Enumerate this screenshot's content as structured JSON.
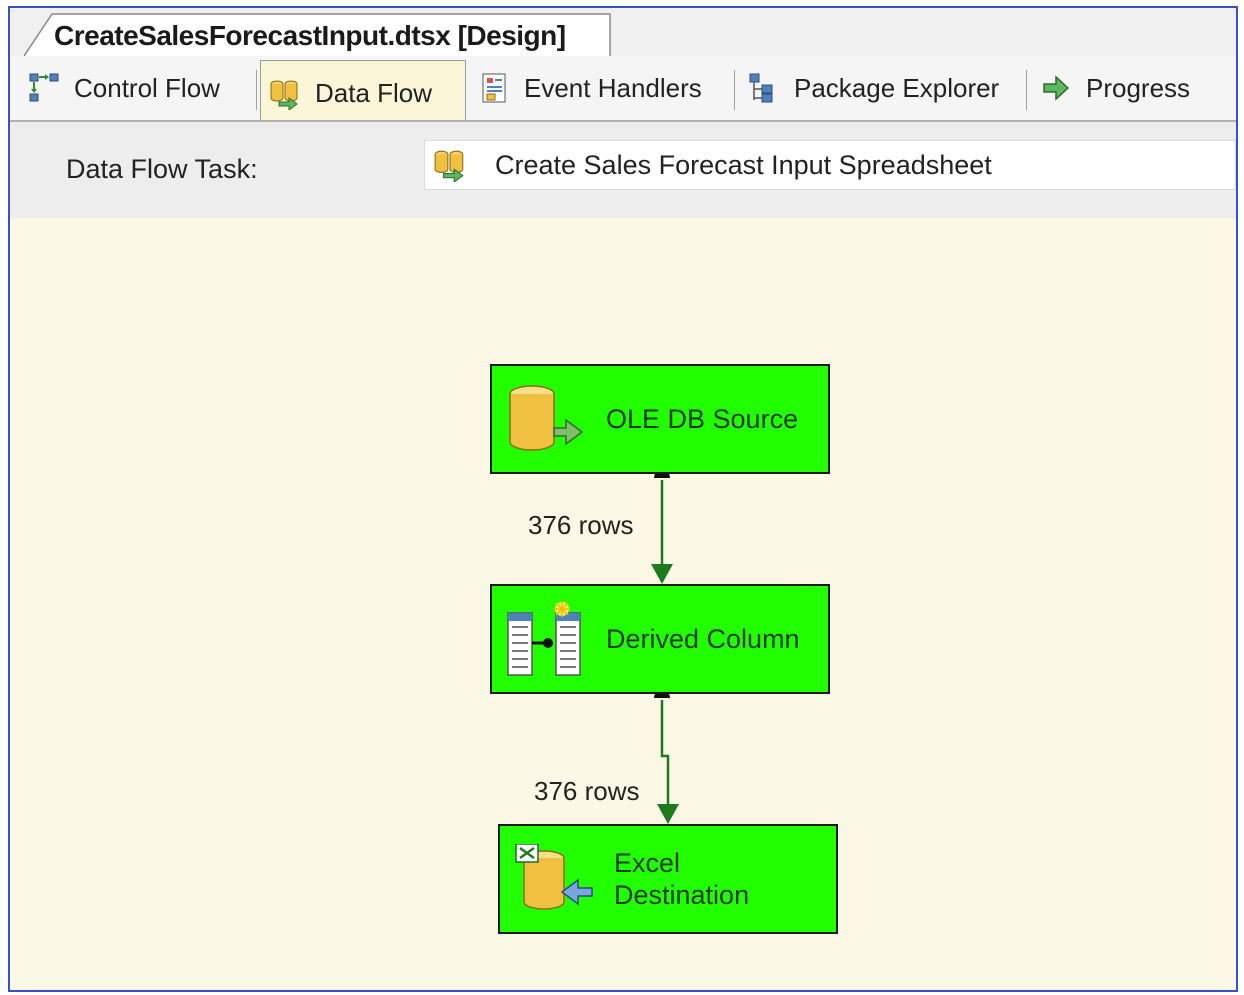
{
  "document": {
    "tab_title": "CreateSalesForecastInput.dtsx [Design]"
  },
  "designer_tabs": [
    {
      "label": "Control Flow",
      "icon": "control-flow-icon",
      "active": false
    },
    {
      "label": "Data Flow",
      "icon": "data-flow-icon",
      "active": true
    },
    {
      "label": "Event Handlers",
      "icon": "event-handlers-icon",
      "active": false
    },
    {
      "label": "Package Explorer",
      "icon": "package-explorer-icon",
      "active": false
    },
    {
      "label": "Progress",
      "icon": "progress-icon",
      "active": false
    }
  ],
  "task_bar": {
    "label": "Data Flow Task:",
    "selected_task": "Create Sales Forecast Input Spreadsheet",
    "icon": "data-flow-icon"
  },
  "components": {
    "source": {
      "label": "OLE DB Source",
      "icon": "ole-db-source-icon"
    },
    "derived": {
      "label": "Derived Column",
      "icon": "derived-column-icon"
    },
    "destination": {
      "label_line1": "Excel",
      "label_line2": "Destination",
      "icon": "excel-destination-icon"
    }
  },
  "paths": [
    {
      "label": "376 rows"
    },
    {
      "label": "376 rows"
    }
  ],
  "colors": {
    "component_fill": "#22ff00",
    "canvas_background": "#fbf9e6",
    "path_color": "#1e7a1e",
    "frame_border": "#3a50c8"
  }
}
